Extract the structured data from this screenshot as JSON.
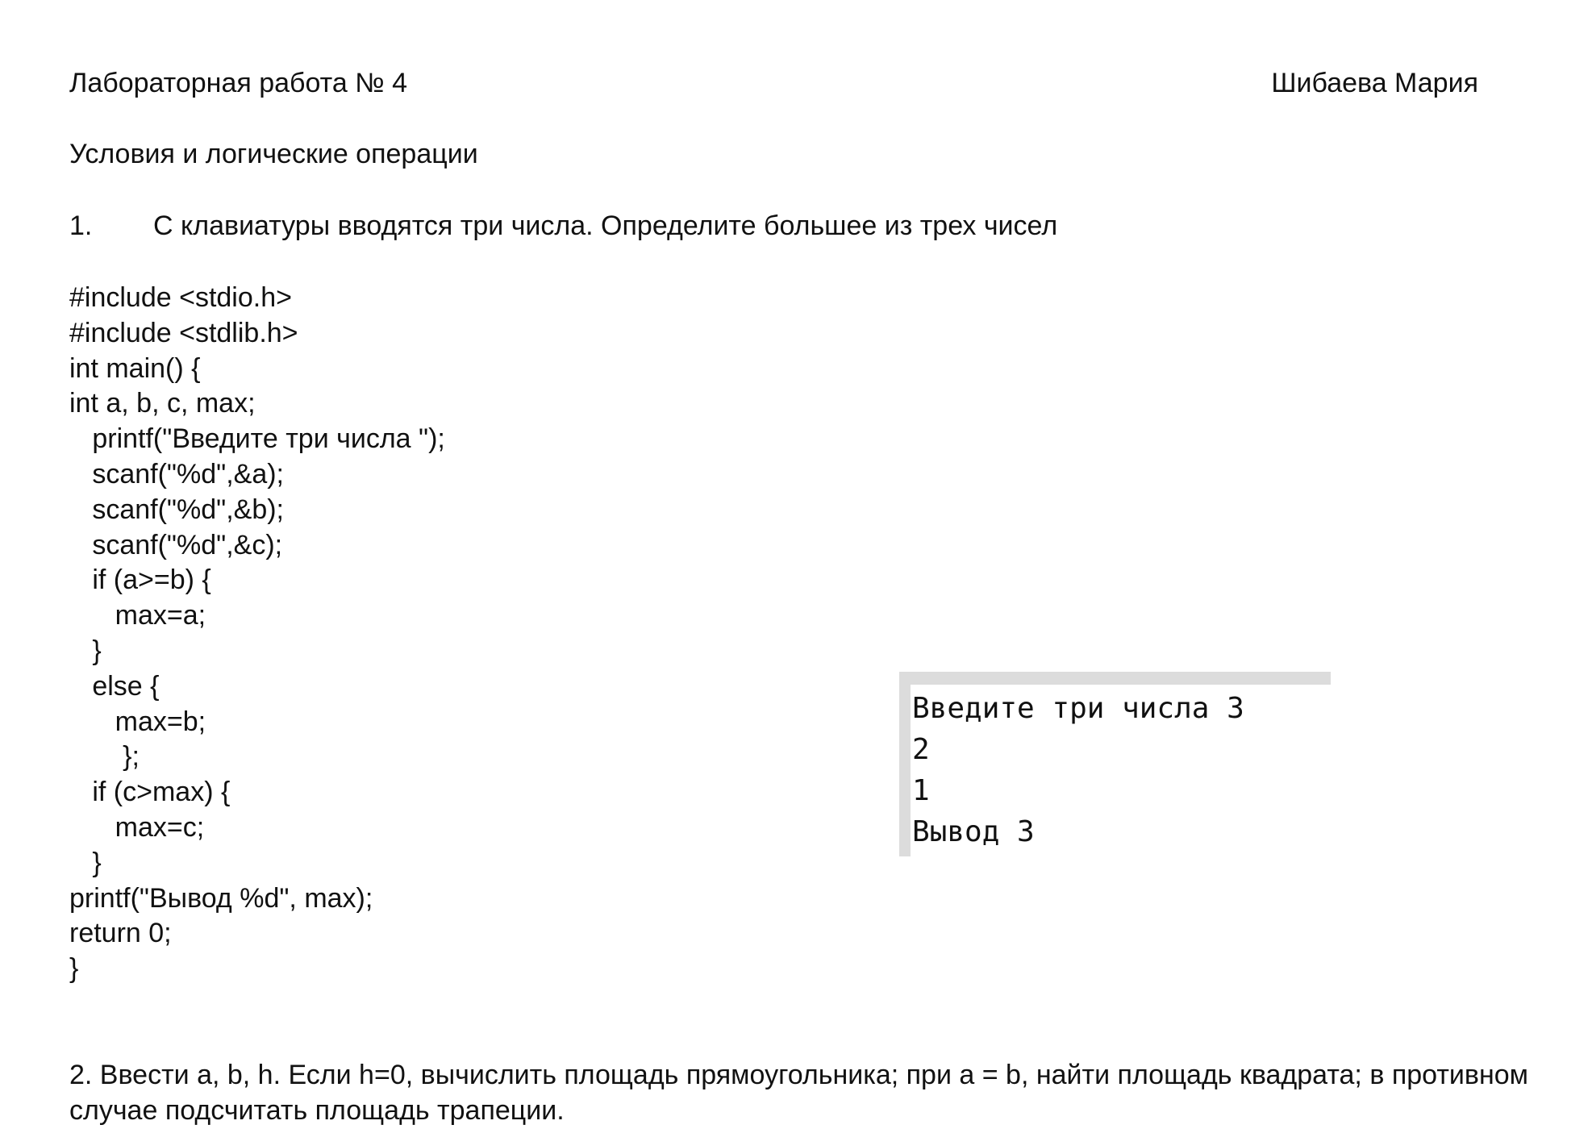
{
  "header": {
    "lab_title": "Лабораторная работа № 4",
    "author": "Шибаева Мария"
  },
  "section_title": "Условия и логические операции",
  "task1": {
    "number": "1.",
    "text": "С клавиатуры вводятся три числа. Определите большее из трех чисел"
  },
  "code_lines": [
    "#include <stdio.h>",
    "#include <stdlib.h>",
    "int main() {",
    "int a, b, c, max;",
    "   printf(\"Введите три числа \");",
    "   scanf(\"%d\",&a);",
    "   scanf(\"%d\",&b);",
    "   scanf(\"%d\",&c);",
    "   if (a>=b) {",
    "      max=a;",
    "   }",
    "   else {",
    "      max=b;",
    "       };",
    "   if (c>max) {",
    "      max=c;",
    "   }",
    "printf(\"Вывод %d\", max);",
    "return 0;",
    "}"
  ],
  "console_output": [
    "Введите три числа 3",
    "2",
    "1",
    "Вывод 3"
  ],
  "task2": {
    "text": "2. Ввести a, b, h. Если h=0, вычислить площадь прямоугольника; при a = b, найти площадь квадрата; в противном случае подсчитать площадь трапеции."
  }
}
